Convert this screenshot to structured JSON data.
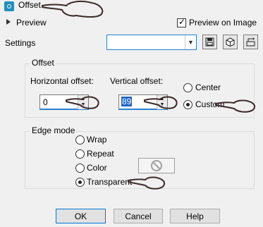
{
  "title": {
    "text": "Offset",
    "icon": "offset-effect-icon"
  },
  "preview": {
    "label": "Preview",
    "preview_on_image_label": "Preview on Image",
    "preview_on_image_checked": true
  },
  "settings": {
    "label": "Settings",
    "value": "",
    "buttons": [
      "save-preset-icon",
      "random-icon",
      "reset-icon"
    ]
  },
  "offset": {
    "title": "Offset",
    "horizontal_label": "Horizontal offset:",
    "horizontal_value": "0",
    "vertical_label": "Vertical offset:",
    "vertical_value": "89",
    "center_label": "Center",
    "custom_label": "Custom",
    "selected": "Custom"
  },
  "edge_mode": {
    "title": "Edge mode",
    "options": [
      "Wrap",
      "Repeat",
      "Color",
      "Transparent"
    ],
    "selected": "Transparent"
  },
  "buttons": {
    "ok": "OK",
    "cancel": "Cancel",
    "help": "Help"
  },
  "colors": {
    "accent": "#2a7fd4",
    "annotation": "#3c2a2a",
    "selection": "#1f63c4"
  }
}
